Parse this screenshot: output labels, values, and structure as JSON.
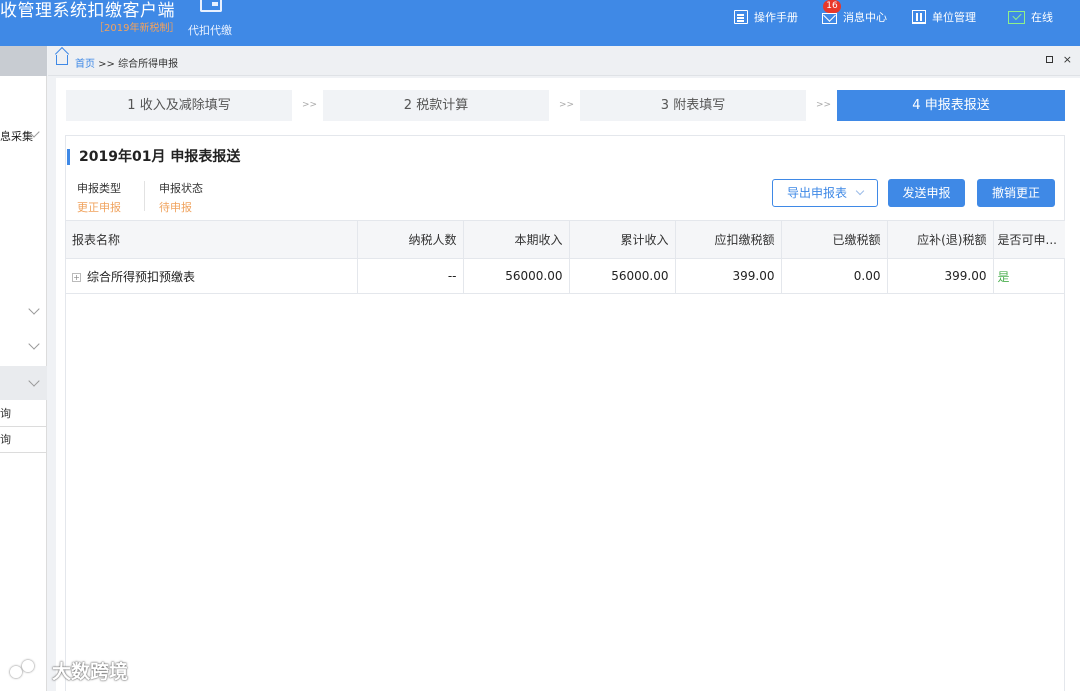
{
  "header": {
    "app_title": "收管理系统扣缴客户端",
    "edition": "［2019年新税制］",
    "mode": "代扣代缴",
    "nav": [
      {
        "label": "操作手册",
        "icon": "manual-icon"
      },
      {
        "label": "消息中心",
        "icon": "mail-icon",
        "badge": "16"
      },
      {
        "label": "单位管理",
        "icon": "building-icon"
      },
      {
        "label": "在线",
        "icon": "online-icon"
      }
    ]
  },
  "sidebar": {
    "items": [
      {
        "label": "息采集"
      },
      {
        "label": "询"
      },
      {
        "label": "询"
      }
    ]
  },
  "breadcrumb": {
    "home": "首页",
    "separator": " >> ",
    "current": "综合所得申报"
  },
  "window": {
    "close": "×"
  },
  "steps": [
    {
      "label": "1 收入及减除填写",
      "active": false
    },
    {
      "label": "2 税款计算",
      "active": false
    },
    {
      "label": "3 附表填写",
      "active": false
    },
    {
      "label": "4 申报表报送",
      "active": true
    }
  ],
  "step_separator": ">>",
  "report": {
    "period": "2019年01月  申报表报送",
    "type_label": "申报类型",
    "type_value": "更正申报",
    "status_label": "申报状态",
    "status_value": "待申报",
    "export_button": "导出申报表",
    "send_button": "发送申报",
    "revoke_button": "撤销更正"
  },
  "table": {
    "headers": [
      "报表名称",
      "纳税人数",
      "本期收入",
      "累计收入",
      "应扣缴税额",
      "已缴税额",
      "应补(退)税额",
      "是否可申..."
    ],
    "rows": [
      {
        "expand": "+",
        "name": "综合所得预扣预缴表",
        "taxpayers": "--",
        "current_income": "56000.00",
        "cumulative_income": "56000.00",
        "withholding_tax": "399.00",
        "paid_tax": "0.00",
        "refund_due": "399.00",
        "can_declare": "是"
      }
    ]
  },
  "watermark": "大数跨境",
  "colors": {
    "brand": "#3f89e6",
    "warning_text": "#f0a35e",
    "success_text": "#4caf50",
    "badge": "#e8372a"
  }
}
